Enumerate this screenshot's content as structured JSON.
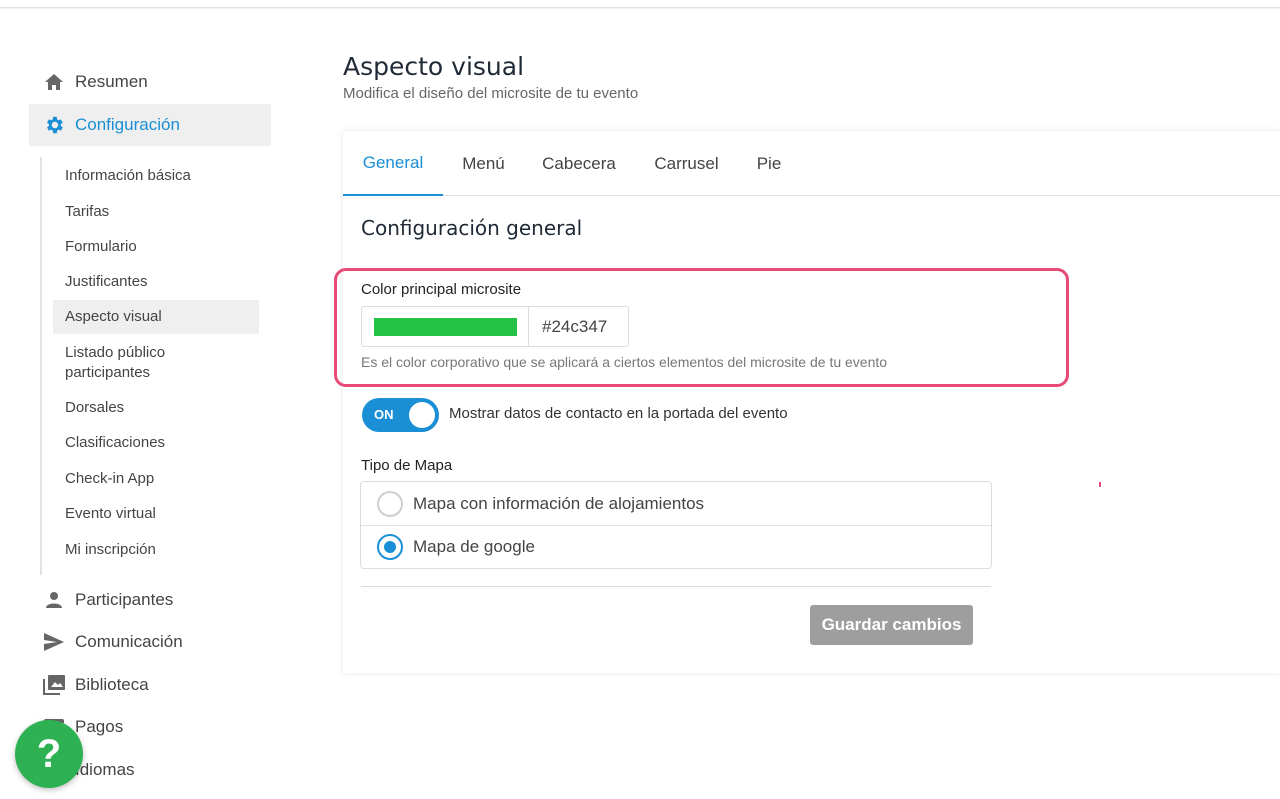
{
  "sidebar": {
    "resumen": "Resumen",
    "configuracion": "Configuración",
    "sub_items": [
      "Información básica",
      "Tarifas",
      "Formulario",
      "Justificantes",
      "Aspecto visual",
      "Listado público participantes",
      "Dorsales",
      "Clasificaciones",
      "Check-in App",
      "Evento virtual",
      "Mi inscripción"
    ],
    "participantes": "Participantes",
    "comunicacion": "Comunicación",
    "biblioteca": "Biblioteca",
    "pagos": "Pagos",
    "idiomas": "Idiomas"
  },
  "header": {
    "title": "Aspecto visual",
    "subtitle": "Modifica el diseño del microsite de tu evento"
  },
  "tabs": [
    "General",
    "Menú",
    "Cabecera",
    "Carrusel",
    "Pie"
  ],
  "general": {
    "section_title": "Configuración general",
    "color_label": "Color principal microsite",
    "color_value": "#24c347",
    "color_help": "Es el color corporativo que se aplicará a ciertos elementos del microsite de tu evento",
    "toggle_state": "ON",
    "toggle_label": "Mostrar datos de contacto en la portada del evento",
    "map_label": "Tipo de Mapa",
    "map_options": [
      "Mapa con información de alojamientos",
      "Mapa de google"
    ],
    "map_selected": "Mapa de google",
    "save_label": "Guardar cambios"
  },
  "help_fab": "?",
  "colors": {
    "accent": "#1a8fd6",
    "highlight": "#e84a78",
    "fab": "#2eb152",
    "button_disabled": "#9e9e9e"
  }
}
